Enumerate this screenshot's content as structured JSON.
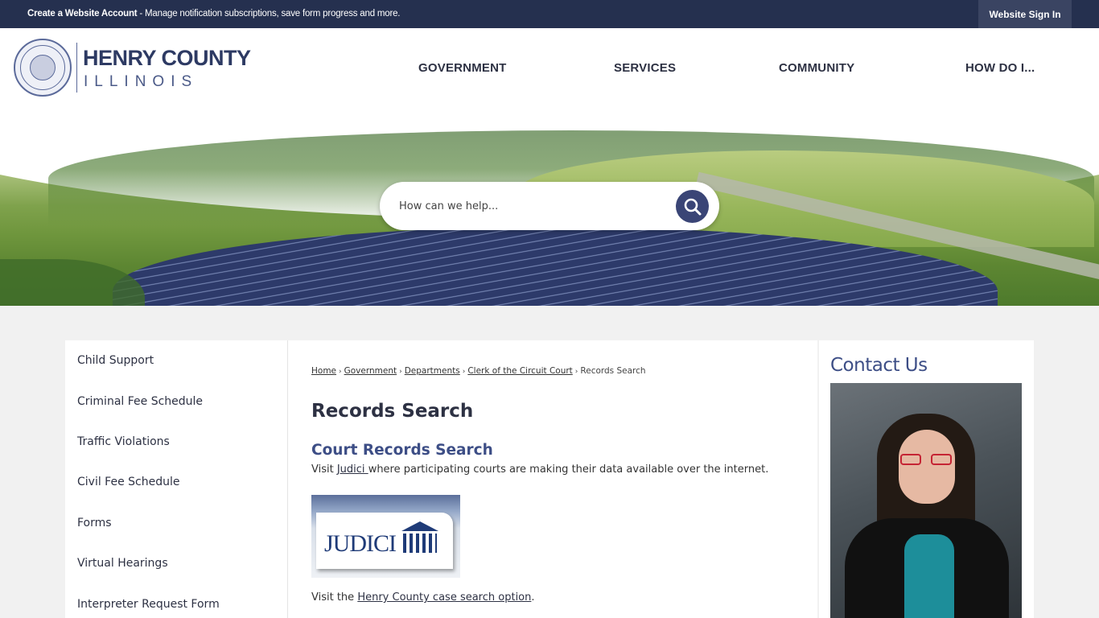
{
  "topbar": {
    "notice_bold": "Create a Website Account",
    "notice_rest": " - Manage notification subscriptions, save form progress and more.",
    "signin": "Website Sign In"
  },
  "logo": {
    "name": "HENRY COUNTY",
    "state": "ILLINOIS"
  },
  "nav": [
    "GOVERNMENT",
    "SERVICES",
    "COMMUNITY",
    "HOW DO I..."
  ],
  "search": {
    "placeholder": "How can we help..."
  },
  "sidebar": {
    "items": [
      "Child Support",
      "Criminal Fee Schedule",
      "Traffic Violations",
      "Civil Fee Schedule",
      "Forms",
      "Virtual Hearings",
      "Interpreter Request Form"
    ]
  },
  "breadcrumb": [
    "Home",
    "Government",
    "Departments",
    "Clerk of the Circuit Court",
    "Records Search"
  ],
  "main": {
    "title": "Records Search",
    "subhead": "Court Records Search",
    "p1_pre": "Visit ",
    "p1_link": "Judici ",
    "p1_post": "where participating courts are making their data available over the internet.",
    "judici_logo_text": "JUDICI",
    "p2_pre": "Visit the ",
    "p2_link": "Henry County case search option",
    "p2_post": "."
  },
  "contact": {
    "title": "Contact Us"
  },
  "colors": {
    "topbar": "#25304f",
    "accent": "#3d4e86",
    "search_button": "#3a4576"
  }
}
